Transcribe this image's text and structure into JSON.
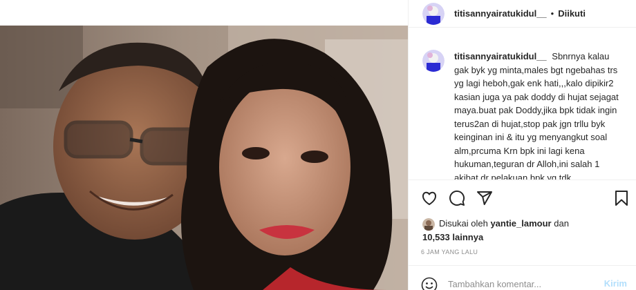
{
  "header": {
    "username": "titisannyairatukidul__",
    "dot": "•",
    "follow_status": "Diikuti"
  },
  "caption": {
    "username": "titisannyairatukidul__",
    "text": "Sbnrnya kalau gak byk yg minta,males bgt ngebahas trs yg lagi heboh,gak enk hati,,,kalo dipikir2 kasian juga ya pak doddy di hujat sejagat maya.buat pak Doddy,jika bpk tidak ingin terus2an di hujat,stop pak jgn trllu byk keinginan ini & itu yg menyangkut soal alm,prcuma Krn bpk ini lagi kena hukuman,teguran dr Alloh,ini salah 1 akibat dr pelakuan bpk yg tdk"
  },
  "actions": {
    "like": "heart-icon",
    "comment": "comment-icon",
    "share": "share-icon",
    "save": "bookmark-icon"
  },
  "likes": {
    "prefix": "Disukai oleh",
    "liker": "yantie_lamour",
    "connector": "dan",
    "count": "10,533 lainnya"
  },
  "timestamp": "6 JAM YANG LALU",
  "comment_input": {
    "placeholder": "Tambahkan komentar...",
    "post_label": "Kirim"
  },
  "colors": {
    "text": "#262626",
    "muted": "#8e8e8e",
    "border": "#efefef",
    "post_disabled": "#b2dffc"
  }
}
